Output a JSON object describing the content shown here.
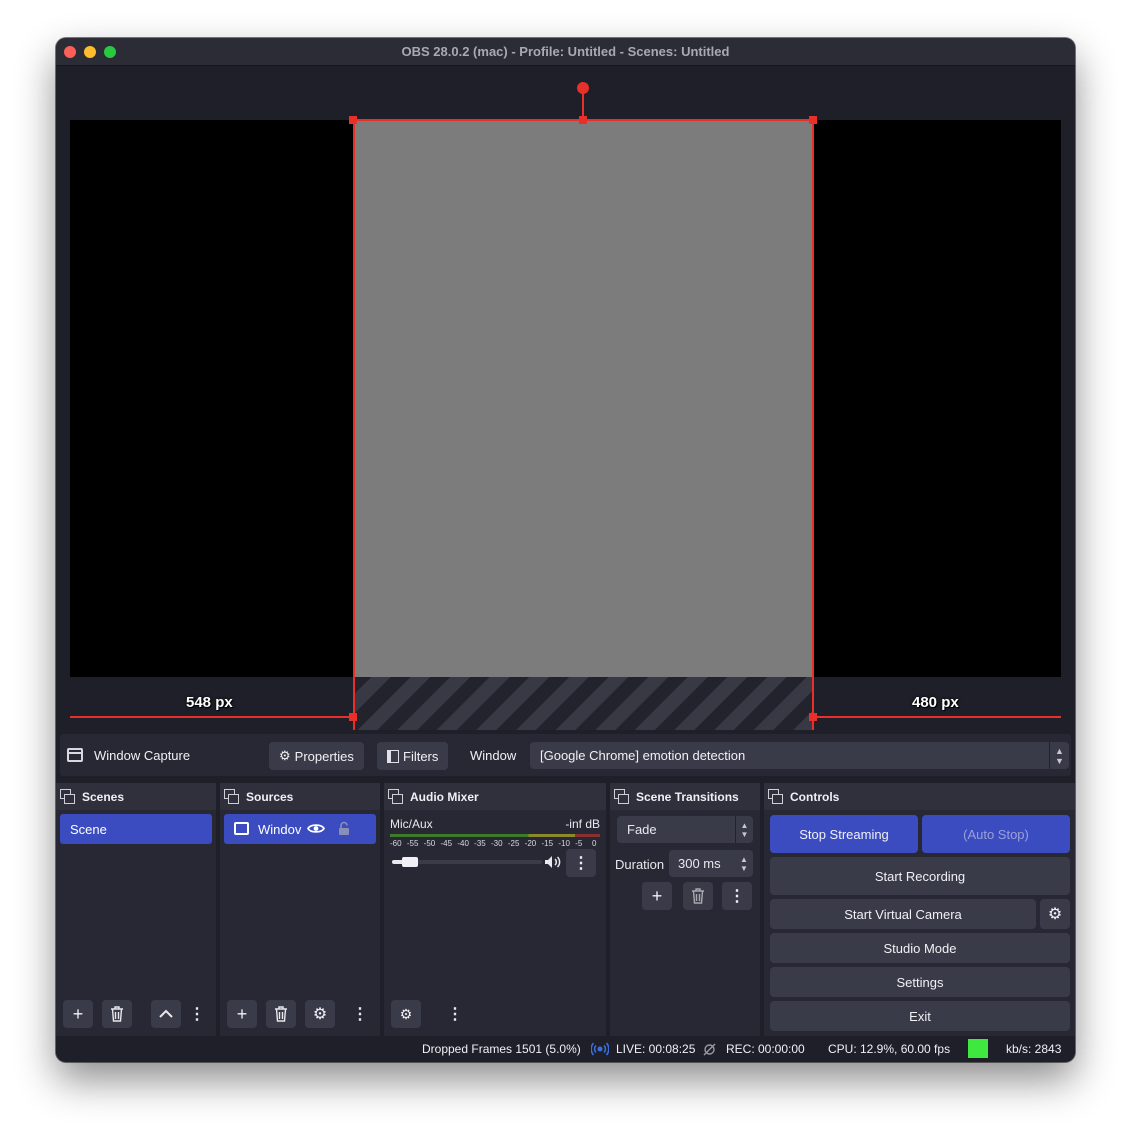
{
  "window": {
    "title": "OBS 28.0.2 (mac) - Profile: Untitled - Scenes: Untitled"
  },
  "preview": {
    "left_px_label": "548 px",
    "right_px_label": "480 px"
  },
  "source_toolbar": {
    "source_name": "Window Capture",
    "properties_label": "Properties",
    "filters_label": "Filters",
    "window_label": "Window",
    "window_value": "[Google Chrome] emotion detection"
  },
  "docks": {
    "scenes": {
      "title": "Scenes",
      "items": [
        "Scene"
      ]
    },
    "sources": {
      "title": "Sources",
      "items": [
        "Windov"
      ]
    },
    "audio_mixer": {
      "title": "Audio Mixer",
      "channel": "Mic/Aux",
      "level": "-inf dB",
      "scale": [
        "-60",
        "-55",
        "-50",
        "-45",
        "-40",
        "-35",
        "-30",
        "-25",
        "-20",
        "-15",
        "-10",
        "-5",
        "0"
      ],
      "volume_fraction": 0.12
    },
    "scene_transitions": {
      "title": "Scene Transitions",
      "transition": "Fade",
      "duration_label": "Duration",
      "duration_value": "300 ms"
    },
    "controls": {
      "title": "Controls",
      "stop_streaming": "Stop Streaming",
      "auto_stop": "(Auto Stop)",
      "start_recording": "Start Recording",
      "start_virtual_camera": "Start Virtual Camera",
      "studio_mode": "Studio Mode",
      "settings": "Settings",
      "exit": "Exit"
    }
  },
  "status": {
    "dropped_frames": "Dropped Frames 1501 (5.0%)",
    "live": "LIVE: 00:08:25",
    "rec": "REC: 00:00:00",
    "cpu": "CPU: 12.9%, 60.00 fps",
    "kbps": "kb/s: 2843",
    "health_color": "#3ee83e"
  },
  "colors": {
    "accent": "#3b4cc0",
    "selection": "#e8302b"
  }
}
